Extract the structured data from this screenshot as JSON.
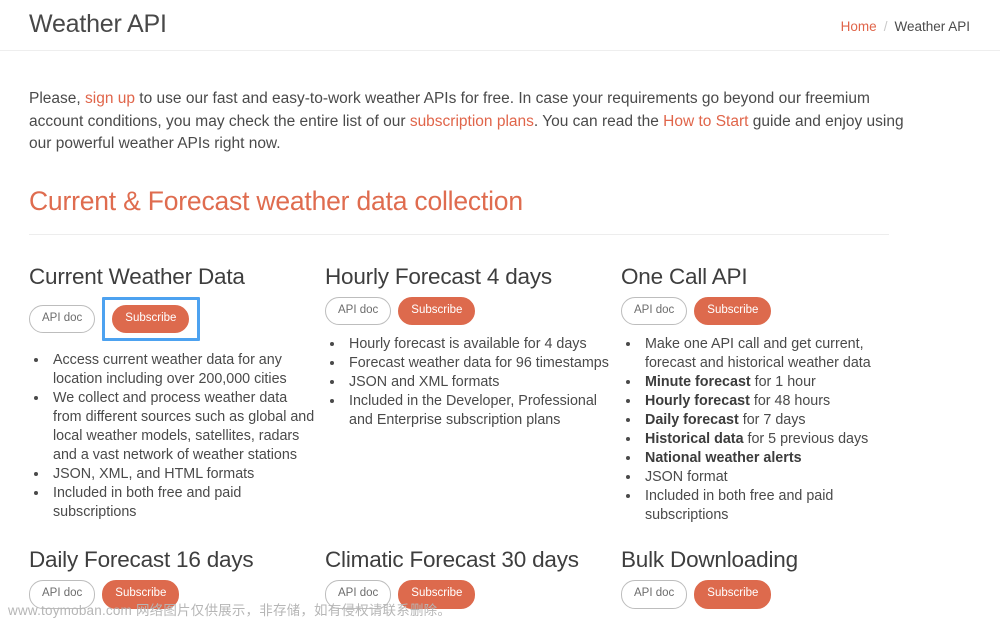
{
  "header": {
    "title": "Weather API",
    "breadcrumb": {
      "home_label": "Home",
      "separator": "/",
      "current_label": "Weather API"
    }
  },
  "intro": {
    "part1": "Please, ",
    "link1": "sign up",
    "part2": " to use our fast and easy-to-work weather APIs for free. In case your requirements go beyond our freemium account conditions, you may check the entire list of our ",
    "link2": "subscription plans",
    "part3": ". You can read the ",
    "link3": "How to Start",
    "part4": " guide and enjoy using our powerful weather APIs right now."
  },
  "section": {
    "heading": "Current & Forecast weather data collection"
  },
  "buttons": {
    "api_doc_label": "API doc",
    "subscribe_label": "Subscribe"
  },
  "cards": {
    "row1": [
      {
        "title": "Current Weather Data",
        "focused_subscribe": true,
        "bullets": [
          [
            {
              "text": "Access current weather data for any location including over 200,000 cities",
              "bold": false
            }
          ],
          [
            {
              "text": "We collect and process weather data from different sources such as global and local weather models, satellites, radars and a vast network of weather stations",
              "bold": false
            }
          ],
          [
            {
              "text": "JSON, XML, and HTML formats",
              "bold": false
            }
          ],
          [
            {
              "text": "Included in both free and paid subscriptions",
              "bold": false
            }
          ]
        ]
      },
      {
        "title": "Hourly Forecast 4 days",
        "focused_subscribe": false,
        "bullets": [
          [
            {
              "text": "Hourly forecast is available for 4 days",
              "bold": false
            }
          ],
          [
            {
              "text": "Forecast weather data for 96 timestamps",
              "bold": false
            }
          ],
          [
            {
              "text": "JSON and XML formats",
              "bold": false
            }
          ],
          [
            {
              "text": "Included in the Developer, Professional and Enterprise subscription plans",
              "bold": false
            }
          ]
        ]
      },
      {
        "title": "One Call API",
        "focused_subscribe": false,
        "bullets": [
          [
            {
              "text": "Make one API call and get current, forecast and historical weather data",
              "bold": false
            }
          ],
          [
            {
              "text": "Minute forecast",
              "bold": true
            },
            {
              "text": " for 1 hour",
              "bold": false
            }
          ],
          [
            {
              "text": "Hourly forecast",
              "bold": true
            },
            {
              "text": " for 48 hours",
              "bold": false
            }
          ],
          [
            {
              "text": "Daily forecast",
              "bold": true
            },
            {
              "text": " for 7 days",
              "bold": false
            }
          ],
          [
            {
              "text": "Historical data",
              "bold": true
            },
            {
              "text": " for 5 previous days",
              "bold": false
            }
          ],
          [
            {
              "text": "National weather alerts",
              "bold": true
            }
          ],
          [
            {
              "text": "JSON format",
              "bold": false
            }
          ],
          [
            {
              "text": "Included in both free and paid subscriptions",
              "bold": false
            }
          ]
        ]
      }
    ],
    "row2": [
      {
        "title": "Daily Forecast 16 days",
        "focused_subscribe": false,
        "bullets": []
      },
      {
        "title": "Climatic Forecast 30 days",
        "focused_subscribe": false,
        "bullets": []
      },
      {
        "title": "Bulk Downloading",
        "focused_subscribe": false,
        "bullets": []
      }
    ]
  },
  "watermark": {
    "text": "www.toymoban.com 网络图片仅供展示，非存储，如有侵权请联系删除。"
  },
  "colors": {
    "accent": "#dd6a4d",
    "heading": "#df6c4f",
    "link": "#e0654a",
    "focus_ring": "#4da2f0",
    "text": "#4a4a4a"
  }
}
